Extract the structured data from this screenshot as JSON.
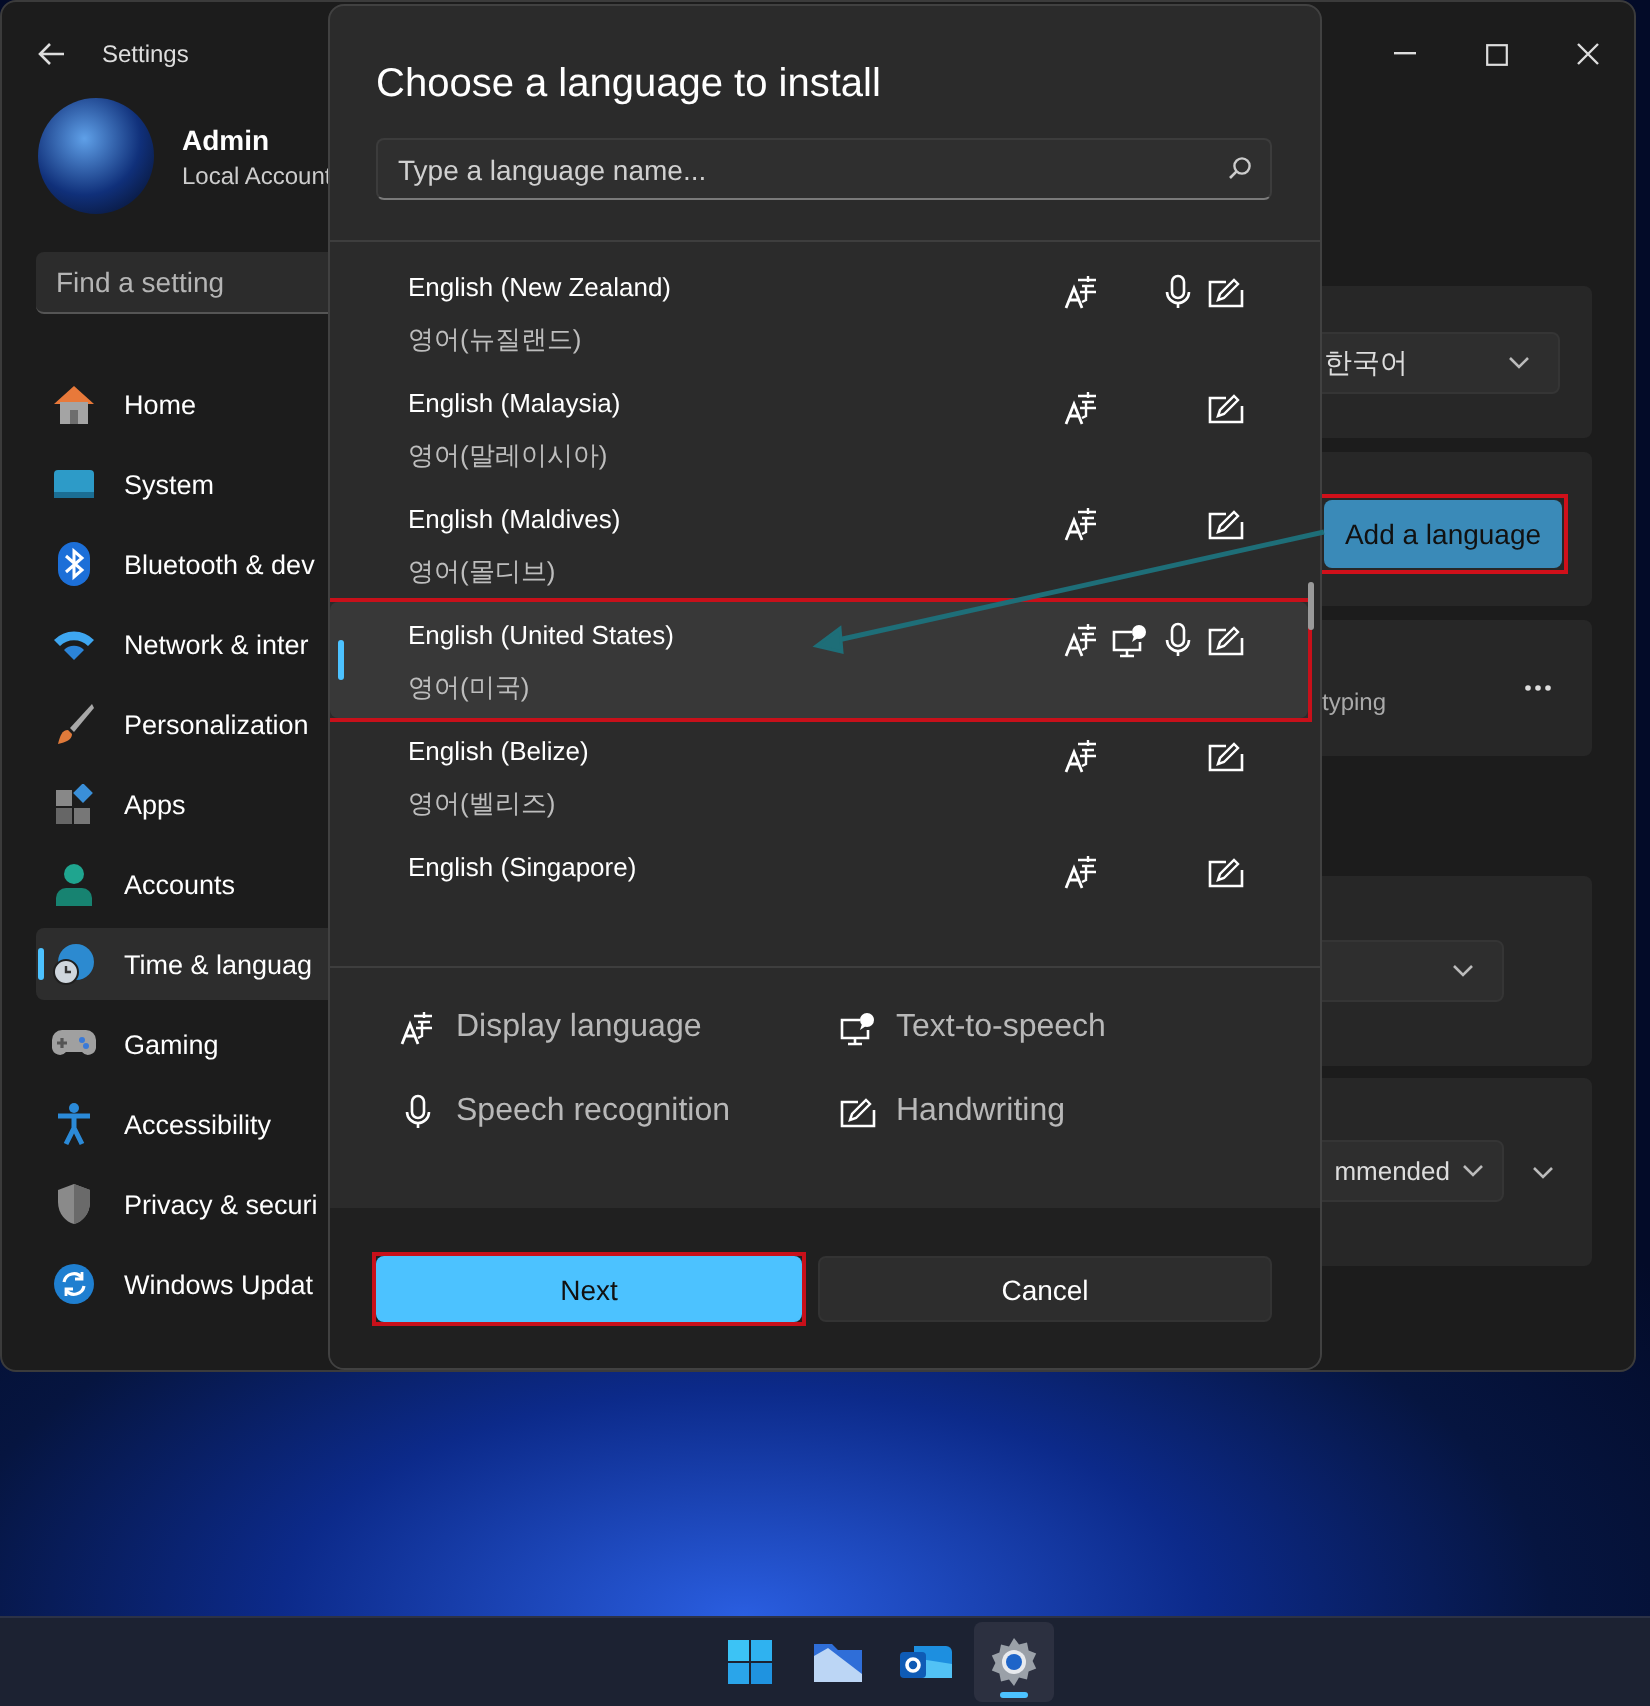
{
  "settings_window": {
    "title": "Settings",
    "account": {
      "name": "Admin",
      "type": "Local Account"
    },
    "search": {
      "placeholder": "Find a setting"
    },
    "sidebar": {
      "items": [
        {
          "label": "Home",
          "selected": false
        },
        {
          "label": "System",
          "selected": false
        },
        {
          "label": "Bluetooth & dev",
          "selected": false
        },
        {
          "label": "Network & inter",
          "selected": false
        },
        {
          "label": "Personalization",
          "selected": false
        },
        {
          "label": "Apps",
          "selected": false
        },
        {
          "label": "Accounts",
          "selected": false
        },
        {
          "label": "Time & languag",
          "selected": true
        },
        {
          "label": "Gaming",
          "selected": false
        },
        {
          "label": "Accessibility",
          "selected": false
        },
        {
          "label": "Privacy & securi",
          "selected": false
        },
        {
          "label": "Windows Updat",
          "selected": false
        }
      ]
    },
    "content": {
      "display_language_dropdown": {
        "value": "한국어"
      },
      "add_language_button": "Add a language",
      "language_card": {
        "text": "typing"
      },
      "regional_format_dropdown": {
        "value": "mmended"
      }
    }
  },
  "dialog": {
    "title": "Choose a language to install",
    "search": {
      "placeholder": "Type a language name..."
    },
    "languages": [
      {
        "name": "English (New Zealand)",
        "native": "영어(뉴질랜드)",
        "display_language": true,
        "text_to_speech": false,
        "speech_recognition": true,
        "handwriting": true,
        "selected": false
      },
      {
        "name": "English (Malaysia)",
        "native": "영어(말레이시아)",
        "display_language": true,
        "text_to_speech": false,
        "speech_recognition": false,
        "handwriting": true,
        "selected": false
      },
      {
        "name": "English (Maldives)",
        "native": "영어(몰디브)",
        "display_language": true,
        "text_to_speech": false,
        "speech_recognition": false,
        "handwriting": true,
        "selected": false
      },
      {
        "name": "English (United States)",
        "native": "영어(미국)",
        "display_language": true,
        "text_to_speech": true,
        "speech_recognition": true,
        "handwriting": true,
        "selected": true
      },
      {
        "name": "English (Belize)",
        "native": "영어(벨리즈)",
        "display_language": true,
        "text_to_speech": false,
        "speech_recognition": false,
        "handwriting": true,
        "selected": false
      },
      {
        "name": "English (Singapore)",
        "display_language": true,
        "text_to_speech": false,
        "speech_recognition": false,
        "handwriting": true,
        "selected": false
      }
    ],
    "legend": [
      {
        "label": "Display language"
      },
      {
        "label": "Text-to-speech"
      },
      {
        "label": "Speech recognition"
      },
      {
        "label": "Handwriting"
      }
    ],
    "buttons": {
      "primary": "Next",
      "secondary": "Cancel"
    }
  },
  "taskbar": {
    "items": [
      {
        "selected": false
      },
      {
        "selected": false
      },
      {
        "selected": false
      },
      {
        "selected": true
      }
    ]
  }
}
